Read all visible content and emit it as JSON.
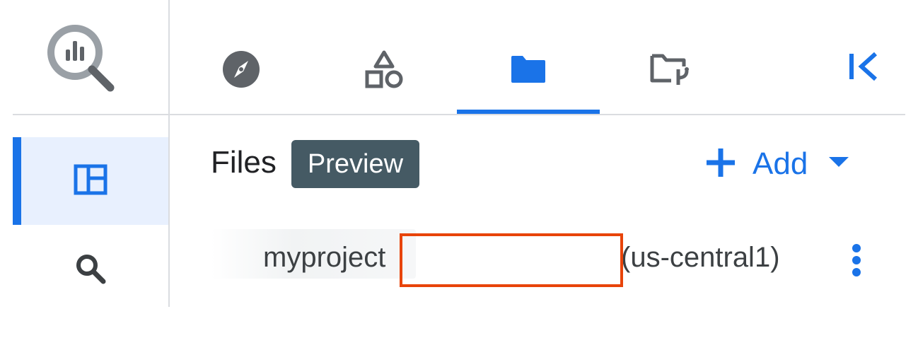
{
  "app": {
    "logo_icon": "bigquery-logo-icon"
  },
  "rail": {
    "items": [
      {
        "icon": "panel-layout-icon",
        "active": true
      },
      {
        "icon": "search-icon",
        "active": false
      }
    ]
  },
  "tabs": [
    {
      "icon": "compass-icon",
      "selected": false
    },
    {
      "icon": "shapes-icon",
      "selected": false
    },
    {
      "icon": "folder-icon",
      "selected": true
    },
    {
      "icon": "folder-git-icon",
      "selected": false
    }
  ],
  "collapse_icon": "collapse-left-icon",
  "files": {
    "title": "Files",
    "badge": "Preview",
    "add_label": "Add"
  },
  "project": {
    "name": "myproject",
    "region": "(us-central1)"
  },
  "colors": {
    "accent": "#1a73e8",
    "badge_bg": "#455a64",
    "highlight": "#e8440a"
  }
}
